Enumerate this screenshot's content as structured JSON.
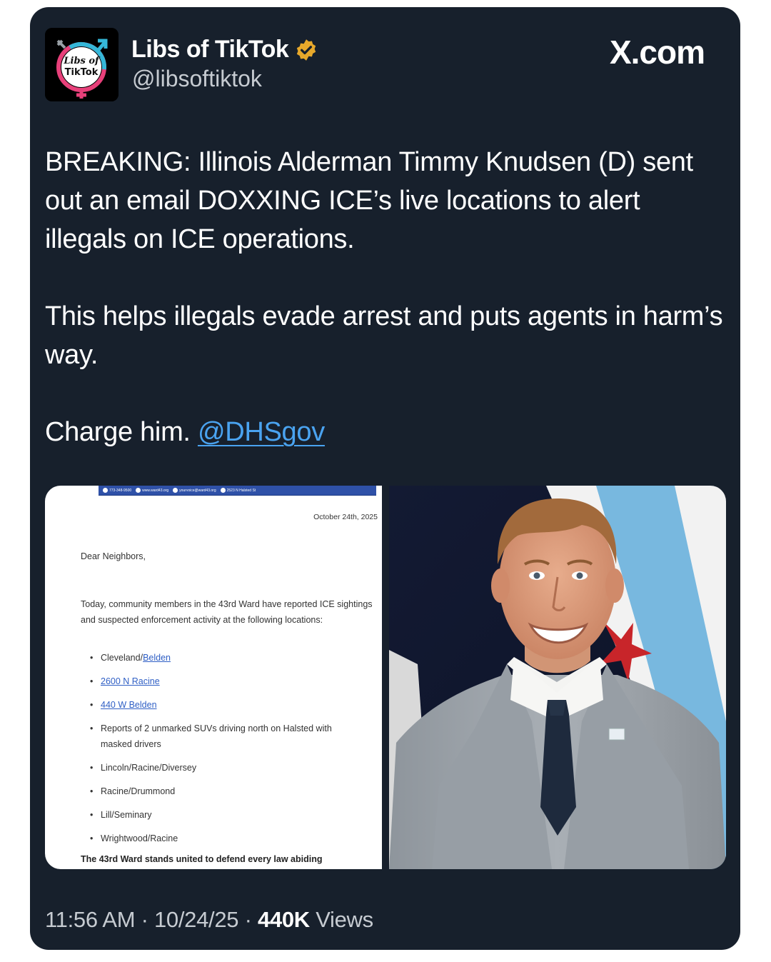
{
  "brand": {
    "site": "X.com"
  },
  "author": {
    "name": "Libs of TikTok",
    "handle": "@libsoftiktok",
    "avatar_text_1": "Libs of",
    "avatar_text_2": "TikTok",
    "verified_icon": "verified-badge-icon"
  },
  "tweet": {
    "para1": "BREAKING: Illinois Alderman Timmy Knudsen (D) sent out an email DOXXING ICE’s live locations to alert illegals on ICE operations.",
    "para2": "This helps illegals evade arrest and puts agents in harm’s way.",
    "para3": "Charge him.",
    "mention": "@DHSgov"
  },
  "email_image": {
    "header_items": [
      "773-348-9500",
      "www.ward43.org",
      "yourvoice@ward43.org",
      "2523 N Halsted St"
    ],
    "date": "October 24th, 2025",
    "greeting": "Dear Neighbors,",
    "intro": "Today, community members in the 43rd Ward have reported ICE sightings and suspected enforcement activity at the following locations:",
    "item1_text": "Cleveland/",
    "item1_link": "Belden",
    "item2_link": "2600 N Racine",
    "item3_link": "440 W Belden",
    "item4_line1": "Reports of 2 unmarked SUVs driving north on Halsted with",
    "item4_line2": "masked drivers",
    "item5": "Lincoln/Racine/Diversey",
    "item6": "Racine/Drummond",
    "item7": "Lill/Seminary",
    "item8": "Wrightwood/Racine",
    "footer": "The 43rd Ward stands united to defend every law abiding"
  },
  "meta": {
    "time": "11:56 AM",
    "date": "10/24/25",
    "views_count": "440K",
    "views_label": "Views",
    "separator": "·"
  },
  "colors": {
    "card_bg": "#17202c",
    "text_primary": "#ffffff",
    "text_secondary": "#c6cbd1",
    "link": "#4aa3f0",
    "verified": "#e7a82b"
  }
}
